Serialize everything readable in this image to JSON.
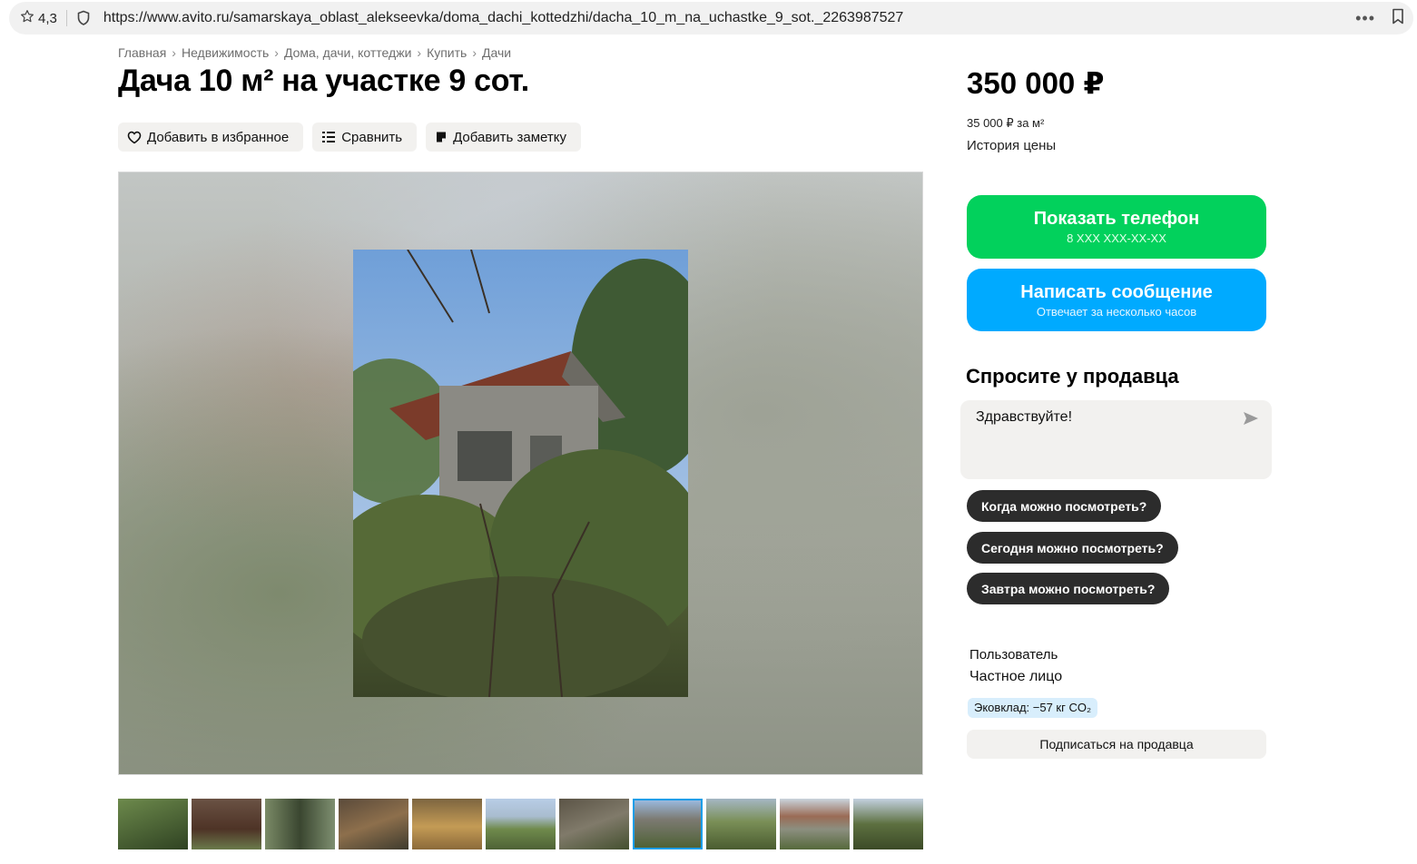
{
  "browser": {
    "rating": "4,3",
    "url": "https://www.avito.ru/samarskaya_oblast_alekseevka/doma_dachi_kottedzhi/dacha_10_m_na_uchastke_9_sot._2263987527",
    "more_icon": "dots-horizontal-icon",
    "bookmark_icon": "bookmark-icon"
  },
  "breadcrumbs": [
    "Главная",
    "Недвижимость",
    "Дома, дачи, коттеджи",
    "Купить",
    "Дачи"
  ],
  "listing": {
    "title": "Дача 10 м² на участке 9 сот.",
    "actions": {
      "favorite": "Добавить в избранное",
      "compare": "Сравнить",
      "note": "Добавить заметку"
    },
    "gallery": {
      "thumbnail_count": 11,
      "active_thumbnail": 8
    }
  },
  "sidebar": {
    "price": "350 000 ₽",
    "price_per_m2": "35 000 ₽ за м²",
    "price_history": "История цены",
    "show_phone": {
      "label": "Показать телефон",
      "sub": "8 XXX XXX-XX-XX"
    },
    "write_message": {
      "label": "Написать сообщение",
      "sub": "Отвечает за несколько часов"
    },
    "ask_title": "Спросите у продавца",
    "message_value": "Здравствуйте!",
    "quick_questions": [
      "Когда можно посмотреть?",
      "Сегодня можно посмотреть?",
      "Завтра можно посмотреть?"
    ],
    "seller": {
      "type": "Пользователь",
      "name": "Частное лицо",
      "eco": "Эковклад: −57 кг CO₂",
      "subscribe": "Подписаться на продавца"
    }
  },
  "colors": {
    "phone_button": "#02d15c",
    "message_button": "#00aaff",
    "chip": "#2c2c2c",
    "active_thumb_border": "#1a9ee8"
  }
}
